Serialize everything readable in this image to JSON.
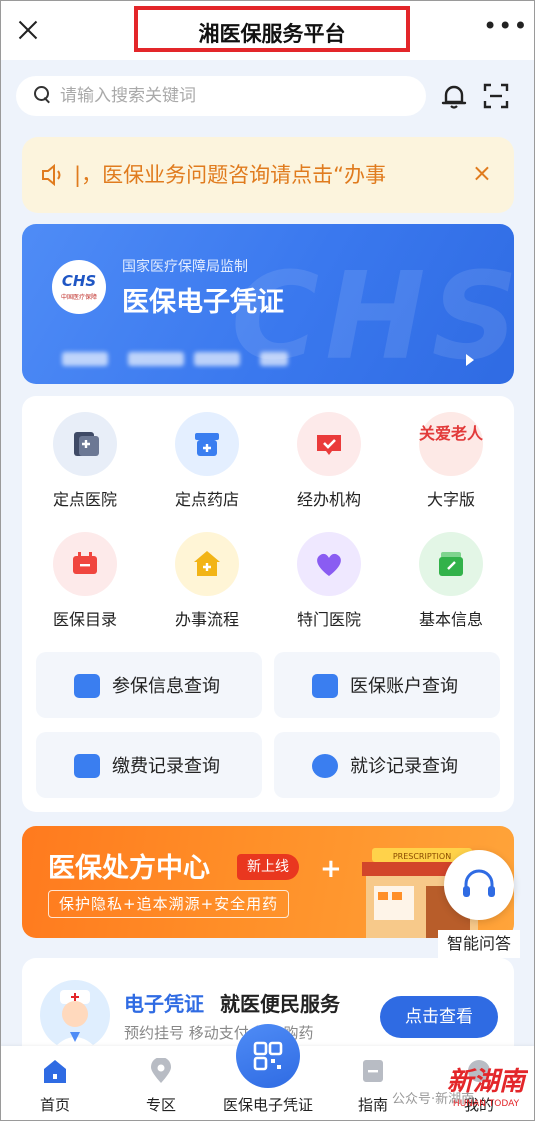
{
  "app": {
    "title": "湘医保服务平台"
  },
  "search": {
    "placeholder": "请输入搜索关键词"
  },
  "notice": {
    "text": "|，医保业务问题咨询请点击“办事",
    "close": "×"
  },
  "card": {
    "subtitle": "国家医疗保障局监制",
    "title": "医保电子凭证",
    "logo_text": "CHS",
    "logo_sub": "中国医疗保障",
    "watermark": "CHS"
  },
  "services": {
    "grid": [
      {
        "label": "定点医院",
        "icon": "hospital-icon",
        "color": "#3f4a66",
        "bg": "#e8eef8"
      },
      {
        "label": "定点药店",
        "icon": "pharmacy-icon",
        "color": "#3a7ef0",
        "bg": "#e4efff"
      },
      {
        "label": "经办机构",
        "icon": "agency-icon",
        "color": "#ea3b3b",
        "bg": "#fdeaea"
      },
      {
        "label": "大字版",
        "icon_text": "关爱老人",
        "color": "#e23a3a",
        "bg": "#fde9e6"
      },
      {
        "label": "医保目录",
        "icon": "catalog-icon",
        "color": "#f0463f",
        "bg": "#fdeaea"
      },
      {
        "label": "办事流程",
        "icon": "process-icon",
        "color": "#f2b416",
        "bg": "#fff5d6"
      },
      {
        "label": "特门医院",
        "icon": "special-hospital-icon",
        "color": "#8a5cf2",
        "bg": "#efe8ff"
      },
      {
        "label": "基本信息",
        "icon": "basic-info-icon",
        "color": "#32b24a",
        "bg": "#e3f6e6"
      }
    ],
    "queries": [
      {
        "label": "参保信息查询",
        "icon": "insurance-info-icon",
        "color": "#3a7ef0"
      },
      {
        "label": "医保账户查询",
        "icon": "account-icon",
        "color": "#3a7ef0"
      },
      {
        "label": "缴费记录查询",
        "icon": "payment-record-icon",
        "color": "#3a7ef0"
      },
      {
        "label": "就诊记录查询",
        "icon": "visit-record-icon",
        "color": "#3a7ef0"
      }
    ]
  },
  "promo": {
    "title": "医保处方中心",
    "badge": "新上线",
    "plus": "+",
    "subtitle": "保护隐私+追本溯源+安全用药",
    "shop_sign": "PRESCRIPTION"
  },
  "assistant": {
    "label": "智能问答"
  },
  "info": {
    "title_blue": "电子凭证",
    "title_black": "就医便民服务",
    "subtitle": "预约挂号  移动支付  处方购药",
    "button": "点击查看"
  },
  "tabs": [
    {
      "label": "首页",
      "icon": "home-icon"
    },
    {
      "label": "专区",
      "icon": "location-icon"
    },
    {
      "label": "医保电子凭证",
      "icon": "qrcode-icon"
    },
    {
      "label": "指南",
      "icon": "guide-icon"
    },
    {
      "label": "我的",
      "icon": "profile-icon"
    }
  ],
  "watermark": {
    "source": "公众号·新湖南",
    "logo_text": "新湖南",
    "logo_sub": "HUNAN TODAY"
  },
  "colors": {
    "primary": "#2f6be3",
    "notice": "#e07b1e",
    "promo": "#ff8f28",
    "highlight_box": "#e3262a"
  }
}
